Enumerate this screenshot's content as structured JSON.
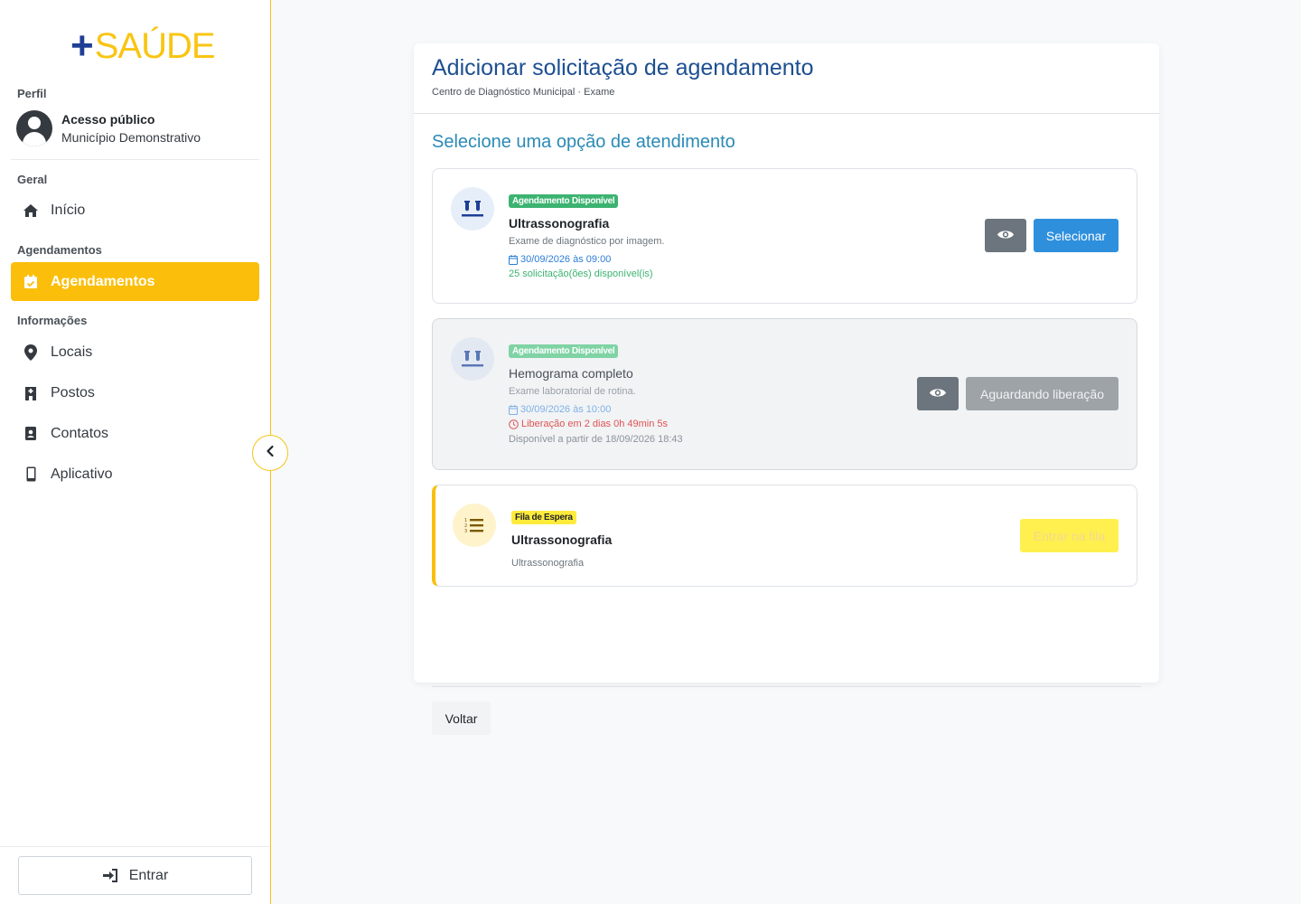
{
  "logo": {
    "plus": "+",
    "text": "SAÚDE"
  },
  "sidebar": {
    "profile_label": "Perfil",
    "profile_name": "Acesso público",
    "profile_city": "Município Demonstrativo",
    "geral_label": "Geral",
    "inicio": "Início",
    "agendamentos_label": "Agendamentos",
    "agendamentos": "Agendamentos",
    "informacoes_label": "Informações",
    "locais": "Locais",
    "postos": "Postos",
    "contatos": "Contatos",
    "aplicativo": "Aplicativo",
    "login": "Entrar"
  },
  "page": {
    "title": "Adicionar solicitação de agendamento",
    "subtitle": "Centro de Diagnóstico Municipal · Exame",
    "select_title": "Selecione uma opção de atendimento",
    "back": "Voltar"
  },
  "options": [
    {
      "badge": "Agendamento Disponível",
      "name": "Ultrassonografia",
      "desc": "Exame de diagnóstico por imagem.",
      "date": "30/09/2026 às 09:00",
      "avail": "25 solicitação(ões) disponível(is)",
      "button": "Selecionar"
    },
    {
      "badge": "Agendamento Disponível",
      "name": "Hemograma completo",
      "desc": "Exame laboratorial de rotina.",
      "date": "30/09/2026 às 10:00",
      "release": "Liberação em 2 dias 0h 49min 5s",
      "from": "Disponível a partir de 18/09/2026 18:43",
      "button": "Aguardando liberação"
    },
    {
      "badge": "Fila de Espera",
      "name": "Ultrassonografia",
      "desc": "Ultrassonografia",
      "button": "Entrar na fila"
    }
  ],
  "colors": {
    "brand_blue": "#1f3f95",
    "brand_yellow": "#f9c513",
    "active_nav": "#fbbf0b",
    "primary": "#2e8fdd"
  }
}
